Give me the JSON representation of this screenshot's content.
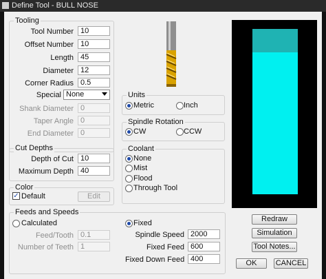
{
  "window": {
    "title": "Define Tool - BULL NOSE"
  },
  "tooling": {
    "label": "Tooling",
    "tool_number": {
      "label": "Tool Number",
      "value": "10"
    },
    "offset_number": {
      "label": "Offset Number",
      "value": "10"
    },
    "length": {
      "label": "Length",
      "value": "45"
    },
    "diameter": {
      "label": "Diameter",
      "value": "12"
    },
    "corner_radius": {
      "label": "Corner Radius",
      "value": "0.5"
    },
    "special": {
      "label": "Special",
      "value": "None"
    },
    "shank_diameter": {
      "label": "Shank Diameter",
      "value": "0"
    },
    "taper_angle": {
      "label": "Taper Angle",
      "value": "0"
    },
    "end_diameter": {
      "label": "End Diameter",
      "value": "0"
    }
  },
  "cut_depths": {
    "label": "Cut Depths",
    "depth_of_cut": {
      "label": "Depth of Cut",
      "value": "10"
    },
    "maximum_depth": {
      "label": "Maximum Depth",
      "value": "40"
    }
  },
  "color": {
    "label": "Color",
    "default_label": "Default",
    "default_checked": true,
    "edit_label": "Edit"
  },
  "units": {
    "label": "Units",
    "metric": "Metric",
    "inch": "Inch",
    "selected": "Metric"
  },
  "spindle_rotation": {
    "label": "Spindle Rotation",
    "cw": "CW",
    "ccw": "CCW",
    "selected": "CW"
  },
  "coolant": {
    "label": "Coolant",
    "options": [
      "None",
      "Mist",
      "Flood",
      "Through Tool"
    ],
    "selected": "None"
  },
  "feeds": {
    "label": "Feeds and Speeds",
    "calculated": "Calculated",
    "fixed": "Fixed",
    "selected": "Fixed",
    "feed_tooth": {
      "label": "Feed/Tooth",
      "value": "0.1"
    },
    "teeth": {
      "label": "Number of Teeth",
      "value": "1"
    },
    "spindle_speed": {
      "label": "Spindle Speed",
      "value": "2000"
    },
    "fixed_feed": {
      "label": "Fixed Feed",
      "value": "600"
    },
    "fixed_down_feed": {
      "label": "Fixed Down Feed",
      "value": "400"
    }
  },
  "buttons": {
    "redraw": "Redraw",
    "simulation": "Simulation",
    "tool_notes": "Tool Notes...",
    "ok": "OK",
    "cancel": "CANCEL"
  },
  "colors": {
    "preview_bg": "#000000",
    "tool_cyan": "#00f0f0",
    "tool_top": "#1fb3b3",
    "gold": "#d9a200"
  }
}
